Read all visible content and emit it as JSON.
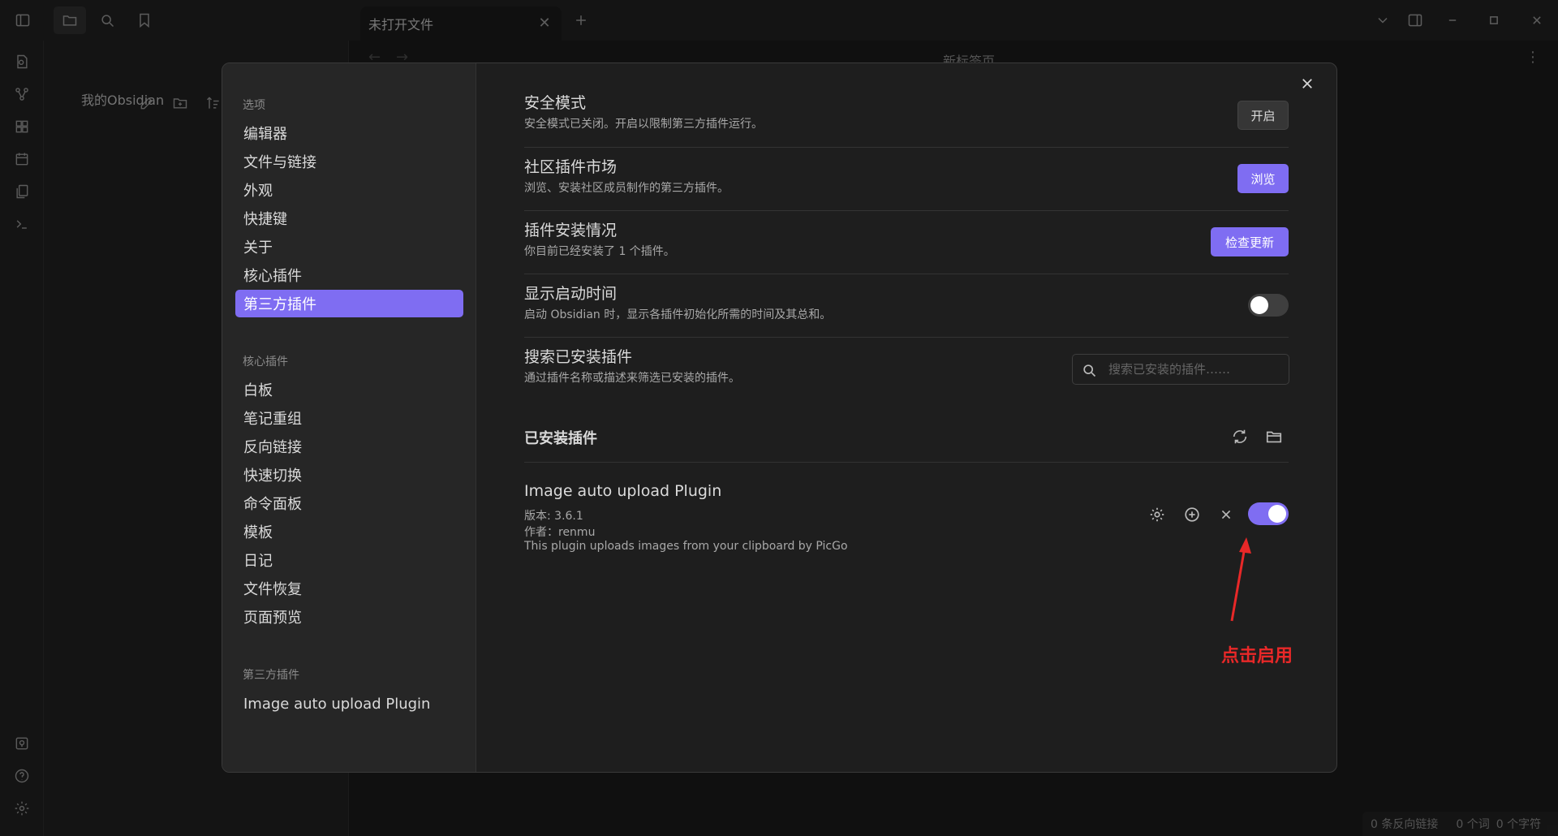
{
  "window": {
    "tab_title": "未打开文件",
    "editor_title": "新标签页",
    "vault_name": "我的Obsidian"
  },
  "settings_sidebar": {
    "options_header": "选项",
    "options": [
      "编辑器",
      "文件与链接",
      "外观",
      "快捷键",
      "关于",
      "核心插件",
      "第三方插件"
    ],
    "active": "第三方插件",
    "core_header": "核心插件",
    "core_plugins": [
      "白板",
      "笔记重组",
      "反向链接",
      "快速切换",
      "命令面板",
      "模板",
      "日记",
      "文件恢复",
      "页面预览"
    ],
    "thirdparty_header": "第三方插件",
    "thirdparty_plugins": [
      "Image auto upload Plugin"
    ]
  },
  "settings": {
    "safe_mode": {
      "name": "安全模式",
      "desc": "安全模式已关闭。开启以限制第三方插件运行。",
      "button": "开启"
    },
    "community": {
      "name": "社区插件市场",
      "desc": "浏览、安装社区成员制作的第三方插件。",
      "button": "浏览"
    },
    "install_status": {
      "name": "插件安装情况",
      "desc": "你目前已经安装了 1 个插件。",
      "button": "检查更新"
    },
    "startup_time": {
      "name": "显示启动时间",
      "desc": "启动 Obsidian 时，显示各插件初始化所需的时间及其总和。",
      "enabled": false
    },
    "search": {
      "name": "搜索已安装插件",
      "desc": "通过插件名称或描述来筛选已安装的插件。",
      "placeholder": "搜索已安装的插件……"
    },
    "installed_header": "已安装插件",
    "plugin": {
      "name": "Image auto upload Plugin",
      "version": "版本: 3.6.1",
      "author": "作者：renmu",
      "desc": "This plugin uploads images from your clipboard by PicGo",
      "enabled": true
    }
  },
  "annotation": "点击启用",
  "status_bar": {
    "backlinks": "0 条反向链接",
    "words": "0 个词",
    "chars": "0 个字符"
  },
  "colors": {
    "accent": "#7f6df2",
    "annotation": "#e82828",
    "background": "#1e1e1e",
    "sidebar": "#262626"
  }
}
